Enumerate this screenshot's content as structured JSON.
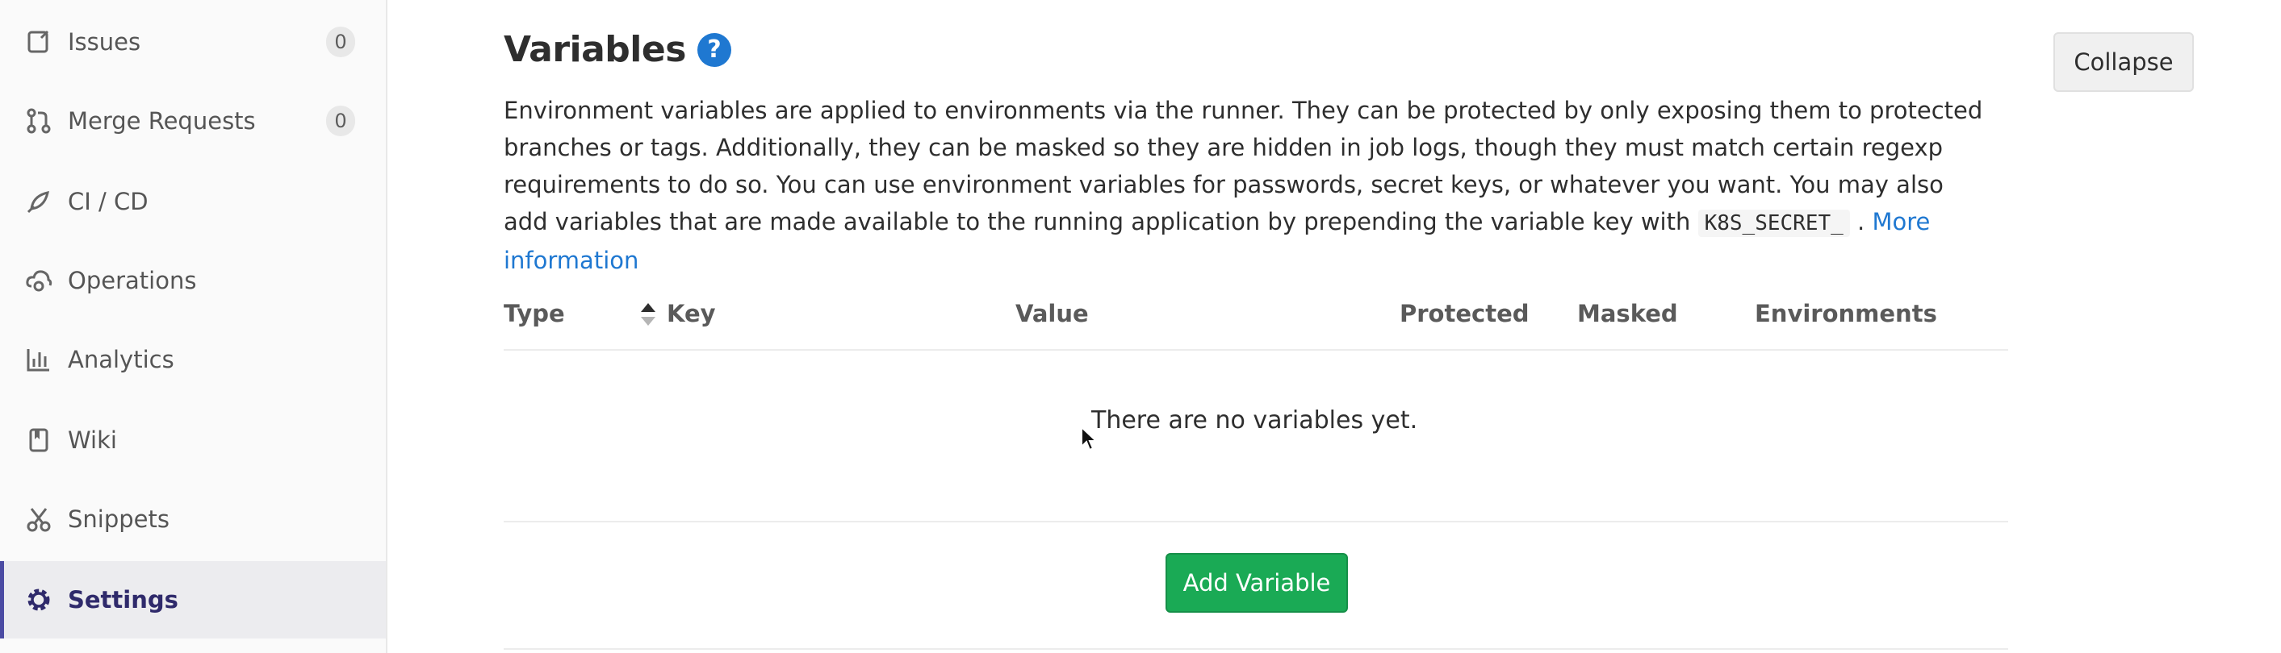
{
  "sidebar": {
    "items": [
      {
        "label": "Issues",
        "count": "0",
        "icon": "issues-icon"
      },
      {
        "label": "Merge Requests",
        "count": "0",
        "icon": "merge-request-icon"
      },
      {
        "label": "CI / CD",
        "icon": "rocket-icon"
      },
      {
        "label": "Operations",
        "icon": "cloud-gear-icon"
      },
      {
        "label": "Analytics",
        "icon": "chart-icon"
      },
      {
        "label": "Wiki",
        "icon": "book-icon"
      },
      {
        "label": "Snippets",
        "icon": "scissors-icon"
      },
      {
        "label": "Settings",
        "icon": "gear-icon",
        "active": true
      }
    ]
  },
  "section": {
    "title": "Variables",
    "help": "?",
    "collapse_label": "Collapse",
    "description": "Environment variables are applied to environments via the runner. They can be protected by only exposing them to protected branches or tags. Additionally, they can be masked so they are hidden in job logs, though they must match certain regexp requirements to do so. You can use environment variables for passwords, secret keys, or whatever you want. You may also add variables that are made available to the running application by prepending the variable key with",
    "code": "K8S_SECRET_",
    "after_code": ".",
    "link": "More information"
  },
  "table": {
    "headers": [
      "Type",
      "Key",
      "Value",
      "Protected",
      "Masked",
      "Environments"
    ],
    "empty_text": "There are no variables yet.",
    "add_button": "Add Variable"
  },
  "colors": {
    "accent": "#1f78d1",
    "success": "#1aaa55",
    "active_nav": "#4b4ba3"
  }
}
